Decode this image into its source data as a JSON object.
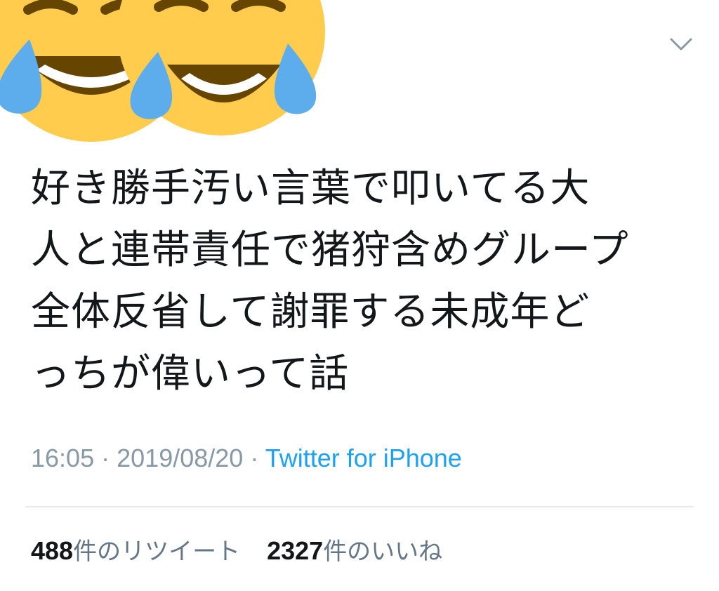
{
  "tweet": {
    "text_lines": [
      "好き勝手汚い言葉で叩いてる大",
      "人と連帯責任で猪狩含めグループ",
      "全体反省して謝罪する未成年ど",
      "っちが偉いって話"
    ],
    "time": "16:05",
    "separator": "·",
    "date": "2019/08/20",
    "source": "Twitter for iPhone",
    "retweets": {
      "count": "488",
      "label": "件のリツイート"
    },
    "likes": {
      "count": "2327",
      "label": "件のいいね"
    }
  },
  "icons": {
    "avatar": "tears-of-joy-emoji-pair",
    "menu": "chevron-down-icon"
  },
  "colors": {
    "text": "#14171a",
    "muted": "#8899a6",
    "link": "#1da1f2",
    "divider": "#e6ecf0",
    "emoji_face": "#ffcc4d",
    "emoji_tear": "#5dadec",
    "emoji_mouth": "#664500"
  }
}
